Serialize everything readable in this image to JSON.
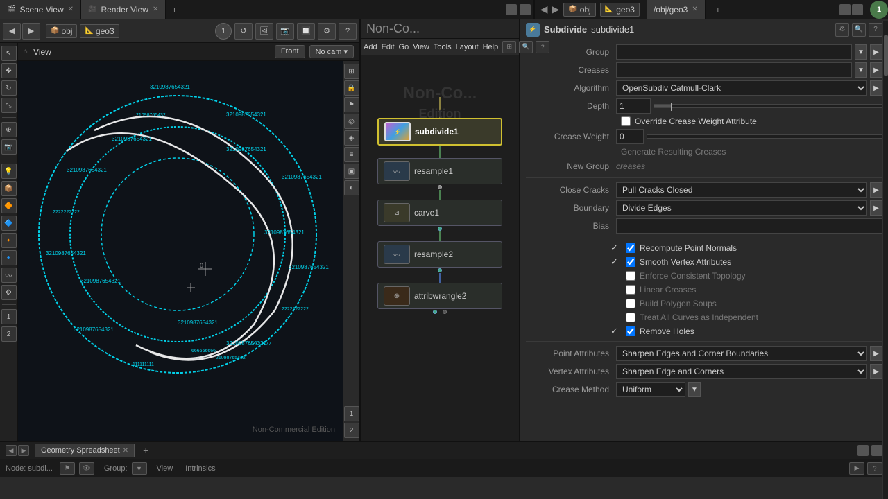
{
  "tabs": {
    "left": [
      {
        "label": "Scene View",
        "active": false
      },
      {
        "label": "Render View",
        "active": true
      }
    ],
    "right": [
      {
        "label": "/obj/geo3",
        "active": true
      }
    ]
  },
  "toolbar": {
    "obj_label": "obj",
    "geo3_label": "geo3",
    "front_btn": "Front",
    "nocam_btn": "No cam ▾",
    "view_label": "View"
  },
  "right_header": {
    "menus": [
      "Add",
      "Edit",
      "Go",
      "View",
      "Tools",
      "Layout",
      "Help"
    ],
    "title": "Subdivide",
    "node_name": "subdivide1",
    "obj_label": "obj",
    "geo3_label": "geo3"
  },
  "properties": {
    "group_label": "Group",
    "creases_label": "Creases",
    "algorithm_label": "Algorithm",
    "algorithm_value": "OpenSubdiv Catmull-Clark",
    "depth_label": "Depth",
    "depth_value": "1",
    "override_crease": "Override Crease Weight Attribute",
    "crease_weight_label": "Crease Weight",
    "crease_weight_value": "0",
    "generate_creases": "Generate Resulting Creases",
    "new_group_label": "New Group",
    "new_group_placeholder": "creases",
    "close_cracks_label": "Close Cracks",
    "close_cracks_value": "Pull Cracks Closed",
    "boundary_label": "Boundary",
    "boundary_value": "Divide Edges",
    "bias_label": "Bias",
    "bias_value": "",
    "checkboxes": [
      {
        "label": "Recompute Point Normals",
        "checked": true
      },
      {
        "label": "Smooth Vertex Attributes",
        "checked": true
      },
      {
        "label": "Enforce Consistent Topology",
        "checked": false
      },
      {
        "label": "Linear Creases",
        "checked": false
      },
      {
        "label": "Build Polygon Soups",
        "checked": false
      },
      {
        "label": "Treat All Curves as Independent",
        "checked": false
      },
      {
        "label": "Remove Holes",
        "checked": true
      }
    ],
    "point_attributes_label": "Point Attributes",
    "point_attributes_value": "Sharpen Edges and Corner Boundaries",
    "vertex_attributes_label": "Vertex Attributes",
    "vertex_attributes_value": "Sharpen Edge and Corners",
    "crease_method_label": "Crease Method",
    "crease_method_value": "Uniform"
  },
  "nodes": [
    {
      "name": "subdivide1",
      "type": "subdivide",
      "id": "n1"
    },
    {
      "name": "resample1",
      "type": "resample",
      "id": "n2"
    },
    {
      "name": "carve1",
      "type": "carve",
      "id": "n3"
    },
    {
      "name": "resample2",
      "type": "resample",
      "id": "n4"
    },
    {
      "name": "attribwrangle2",
      "type": "attrib",
      "id": "n5"
    }
  ],
  "bottom": {
    "tab_label": "Geometry Spreadsheet",
    "node_info": "Node: subdi...",
    "group_label": "Group:",
    "view_label": "View",
    "intrinsics_label": "Intrinsics"
  },
  "viewport": {
    "non_commercial": "Non-Commercial Edition"
  },
  "icons": {
    "search": "🔍",
    "gear": "⚙",
    "help": "?",
    "close": "✕",
    "add": "+",
    "arrow_right": "▶",
    "arrow_down": "▼",
    "arrow_left": "◀",
    "chevron_right": "❯",
    "lock": "🔒",
    "eye": "👁",
    "camera": "📷",
    "home": "⌂",
    "flag": "⚑"
  }
}
